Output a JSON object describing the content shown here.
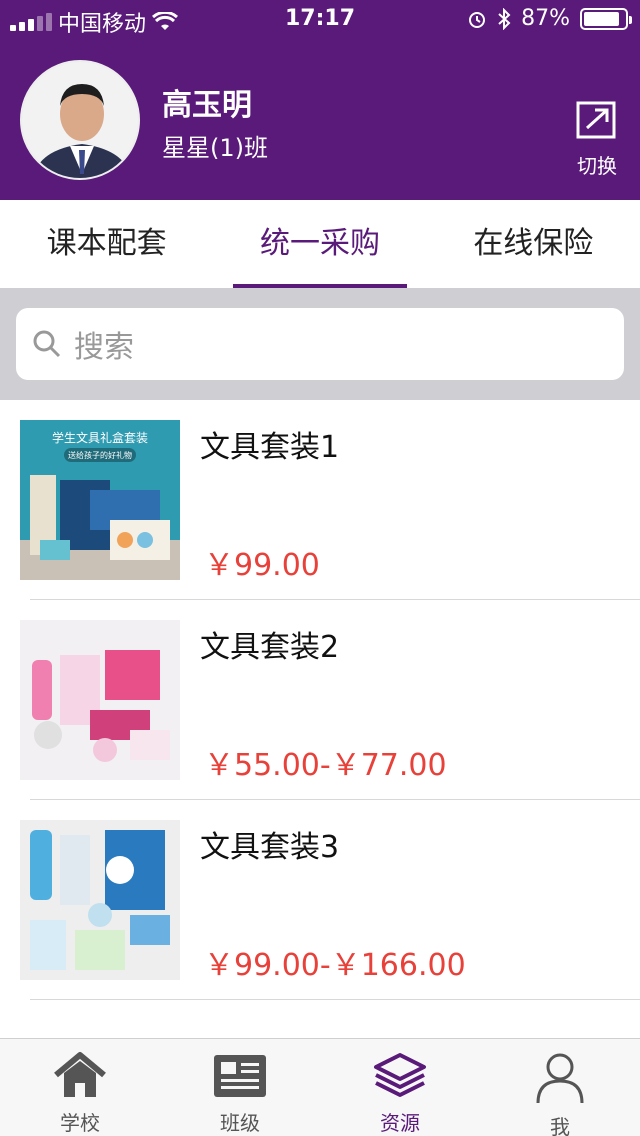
{
  "status_bar": {
    "carrier": "中国移动",
    "time": "17:17",
    "battery": "87%",
    "battery_level": 0.87
  },
  "profile": {
    "name": "高玉明",
    "class_name": "星星(1)班",
    "switch_label": "切换"
  },
  "tabs": [
    {
      "label": "课本配套",
      "active": false
    },
    {
      "label": "统一采购",
      "active": true
    },
    {
      "label": "在线保险",
      "active": false
    }
  ],
  "search": {
    "placeholder": "搜索"
  },
  "products": [
    {
      "title": "文具套装1",
      "price": "￥99.00",
      "thumb_banner": "学生文具礼盒套装",
      "thumb_sub": "送给孩子的好礼物"
    },
    {
      "title": "文具套装2",
      "price": "￥55.00-￥77.00"
    },
    {
      "title": "文具套装3",
      "price": "￥99.00-￥166.00"
    }
  ],
  "bottom_nav": [
    {
      "label": "学校",
      "icon": "home-icon",
      "active": false
    },
    {
      "label": "班级",
      "icon": "newspaper-icon",
      "active": false
    },
    {
      "label": "资源",
      "icon": "layers-icon",
      "active": true
    },
    {
      "label": "我",
      "icon": "person-icon",
      "active": false
    }
  ],
  "colors": {
    "brand": "#5a1a7a",
    "price": "#e8413a"
  }
}
